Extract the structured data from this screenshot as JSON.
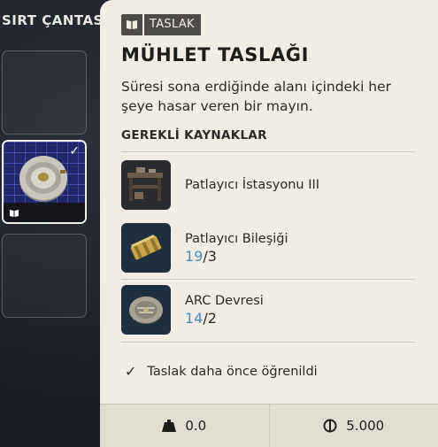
{
  "inventory": {
    "title": "SIRT ÇANTASI"
  },
  "tooltip": {
    "tag_label": "TASLAK",
    "title": "MÜHLET TASLAĞI",
    "description": "Süresi sona erdiğinde alanı içindeki her şeye hasar veren bir mayın.",
    "resources_label": "GEREKLİ KAYNAKLAR",
    "resources": [
      {
        "name": "Patlayıcı İstasyonu III",
        "have": "",
        "need": ""
      },
      {
        "name": "Patlayıcı Bileşiği",
        "have": "19",
        "need": "/3"
      },
      {
        "name": "ARC Devresi",
        "have": "14",
        "need": "/2"
      }
    ],
    "learned_text": "Taslak daha önce öğrenildi",
    "footer": {
      "weight": "0.0",
      "price": "5.000"
    }
  },
  "colors": {
    "card_bg": "#f1ede4",
    "tag_bg": "#4d4b47",
    "have_count": "#4a8bbf",
    "slot_selected": "#20286a"
  },
  "icons": [
    "book-icon",
    "check-icon",
    "weight-icon",
    "coin-icon"
  ]
}
